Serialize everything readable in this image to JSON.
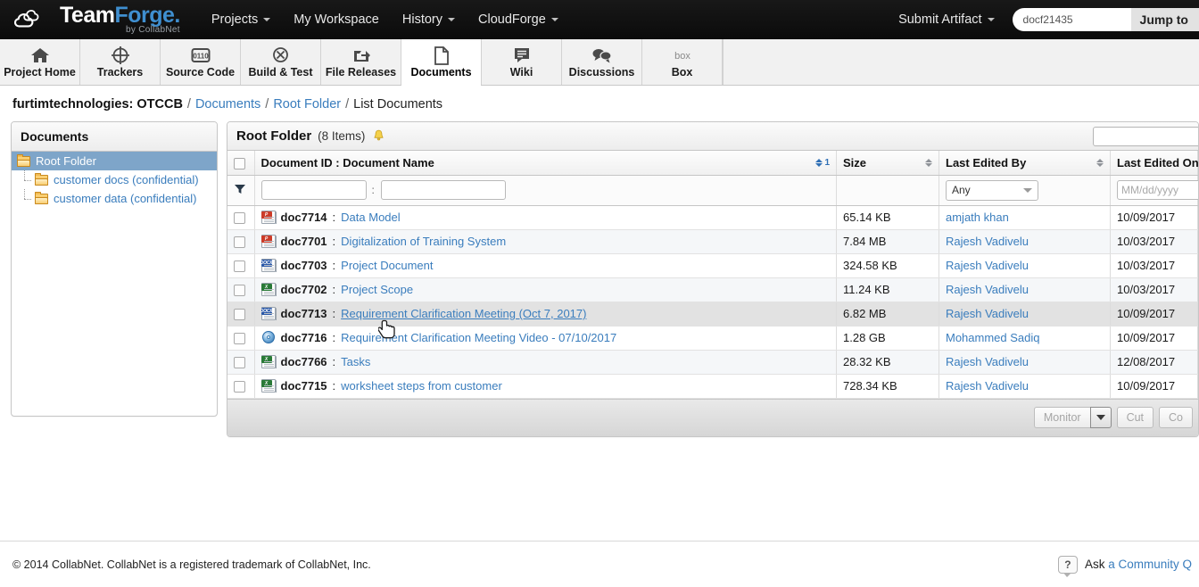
{
  "brand": {
    "name_team": "Team",
    "name_forge": "Forge",
    "dot": ".",
    "tagline": "by CollabNet",
    "logo_icon": "collabnet-cloud-logo"
  },
  "topnav": {
    "items": [
      {
        "label": "Projects",
        "has_caret": true
      },
      {
        "label": "My Workspace",
        "has_caret": false
      },
      {
        "label": "History",
        "has_caret": true
      },
      {
        "label": "CloudForge",
        "has_caret": true
      }
    ],
    "submit_artifact": "Submit Artifact",
    "jump_value": "docf21435",
    "jump_placeholder": "docf21435",
    "jump_button": "Jump to"
  },
  "tabs": [
    {
      "label": "Project Home",
      "icon": "home-icon",
      "active": false
    },
    {
      "label": "Trackers",
      "icon": "target-icon",
      "active": false
    },
    {
      "label": "Source Code",
      "icon": "binary-code-icon",
      "active": false
    },
    {
      "label": "Build & Test",
      "icon": "build-gear-icon",
      "active": false
    },
    {
      "label": "File Releases",
      "icon": "share-arrow-icon",
      "active": false
    },
    {
      "label": "Documents",
      "icon": "document-page-icon",
      "active": true
    },
    {
      "label": "Wiki",
      "icon": "wiki-lines-icon",
      "active": false
    },
    {
      "label": "Discussions",
      "icon": "speech-bubbles-icon",
      "active": false
    },
    {
      "label": "Box",
      "icon": "box-logo-icon",
      "active": false
    }
  ],
  "breadcrumb": {
    "project": "furtimtechnologies: OTCCB",
    "sep": "/",
    "links": [
      "Documents",
      "Root Folder"
    ],
    "current": "List Documents"
  },
  "sidebar": {
    "title": "Documents",
    "tree": [
      {
        "label": "Root Folder",
        "selected": true,
        "child": false
      },
      {
        "label": "customer docs (confidential)",
        "selected": false,
        "child": true
      },
      {
        "label": "customer data (confidential)",
        "selected": false,
        "child": true
      }
    ]
  },
  "panel": {
    "title": "Root Folder",
    "count": "(8 Items)",
    "bell_icon": "monitor-bell-icon",
    "search_placeholder": ""
  },
  "table": {
    "columns": [
      {
        "key": "name",
        "label": "Document ID : Document Name",
        "sorted": true,
        "sort_rank": "1"
      },
      {
        "key": "size",
        "label": "Size",
        "sorted": false,
        "sort_rank": ""
      },
      {
        "key": "by",
        "label": "Last Edited By",
        "sorted": false,
        "sort_rank": ""
      },
      {
        "key": "on",
        "label": "Last Edited On",
        "sorted": false,
        "sort_rank": ""
      }
    ],
    "filters": {
      "id_value": "",
      "id_placeholder": "",
      "colon": ":",
      "name_value": "",
      "name_placeholder": "",
      "size_value": "",
      "by_value": "Any",
      "on_placeholder": "MM/dd/yyyy",
      "filter_icon": "funnel-filter-icon"
    },
    "rows": [
      {
        "id": "doc7714",
        "name": "Data Model",
        "icon": "ppt",
        "size": "65.14 KB",
        "by": "amjath khan",
        "on": "10/09/2017",
        "hovered": false
      },
      {
        "id": "doc7701",
        "name": "Digitalization of Training System",
        "icon": "ppt",
        "size": "7.84 MB",
        "by": "Rajesh Vadivelu",
        "on": "10/03/2017",
        "hovered": false
      },
      {
        "id": "doc7703",
        "name": "Project Document",
        "icon": "doc",
        "size": "324.58 KB",
        "by": "Rajesh Vadivelu",
        "on": "10/03/2017",
        "hovered": false
      },
      {
        "id": "doc7702",
        "name": "Project Scope",
        "icon": "xls",
        "size": "11.24 KB",
        "by": "Rajesh Vadivelu",
        "on": "10/03/2017",
        "hovered": false
      },
      {
        "id": "doc7713",
        "name": "Requirement Clarification Meeting (Oct 7, 2017)",
        "icon": "doc",
        "size": "6.82 MB",
        "by": "Rajesh Vadivelu",
        "on": "10/09/2017",
        "hovered": true
      },
      {
        "id": "doc7716",
        "name": "Requirement Clarification Meeting Video - 07/10/2017",
        "icon": "media",
        "size": "1.28 GB",
        "by": "Mohammed Sadiq",
        "on": "10/09/2017",
        "hovered": false
      },
      {
        "id": "doc7766",
        "name": "Tasks",
        "icon": "xls",
        "size": "28.32 KB",
        "by": "Rajesh Vadivelu",
        "on": "12/08/2017",
        "hovered": false
      },
      {
        "id": "doc7715",
        "name": "worksheet steps from customer",
        "icon": "xls",
        "size": "728.34 KB",
        "by": "Rajesh Vadivelu",
        "on": "10/09/2017",
        "hovered": false
      }
    ]
  },
  "toolbar": {
    "monitor": "Monitor",
    "cut": "Cut",
    "copy": "Co"
  },
  "footer": {
    "copyright": "© 2014 CollabNet. CollabNet is a registered trademark of CollabNet, Inc.",
    "ask_prefix": "Ask ",
    "ask_link": "a Community Q",
    "help_icon": "help-question-bubble-icon"
  },
  "colors": {
    "link": "#3a7dbd",
    "brand_blue": "#3f8fd0",
    "selected_row": "#7ea5c9",
    "topbar": "#101010"
  }
}
